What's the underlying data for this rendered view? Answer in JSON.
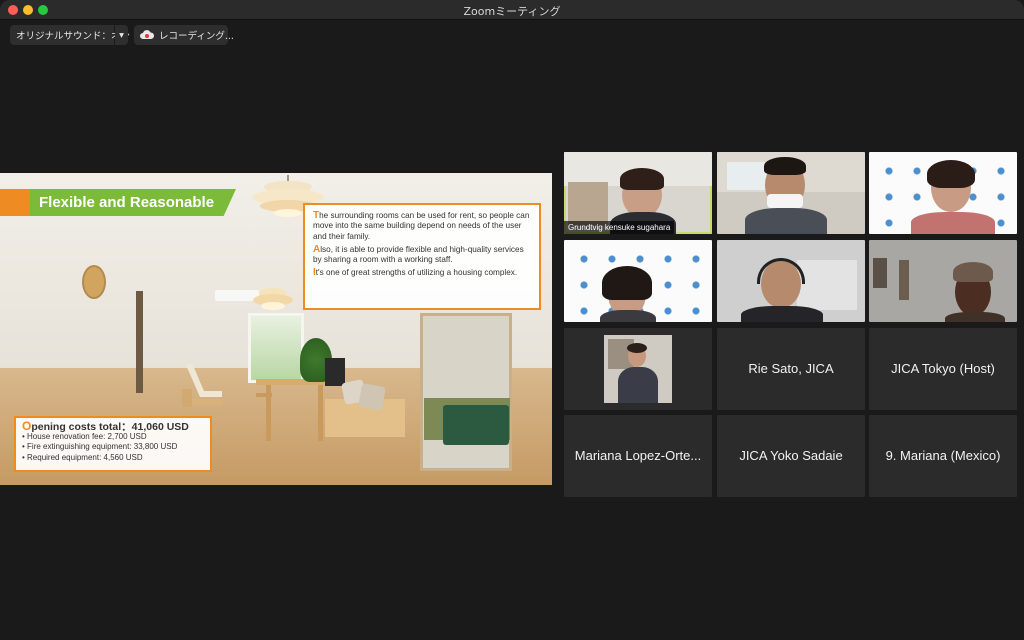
{
  "window": {
    "title": "Zoomミーティング"
  },
  "toolbar": {
    "sound_label": "オリジナルサウンド：オン",
    "dropdown_glyph": "▾",
    "recording_label": "レコーディング..."
  },
  "slide": {
    "banner_title": "Flexible and Reasonable",
    "paragraphs": [
      {
        "cap": "T",
        "rest": "he surrounding rooms can be used for rent, so people can move into the same building depend on needs of the user and their family."
      },
      {
        "cap": "A",
        "rest": "lso, it is able to provide flexible and high-quality services by sharing a room with a working staff."
      },
      {
        "cap": "I",
        "rest": "t's one of great  strengths of utilizing a housing complex."
      }
    ],
    "costs": {
      "cap": "O",
      "title_rest": "pening costs total：41,060 USD",
      "items": [
        "House renovation fee: 2,700 USD",
        "Fire extinguishing equipment: 33,800 USD",
        "Required equipment: 4,560 USD"
      ]
    }
  },
  "participants": [
    {
      "label": "Grundtvig   kensuke sugahara",
      "video": true
    },
    {
      "label": "",
      "video": true
    },
    {
      "label": "",
      "video": true
    },
    {
      "label": "",
      "video": true
    },
    {
      "label": "",
      "video": true
    },
    {
      "label": "",
      "video": true
    },
    {
      "label": "",
      "video": true
    },
    {
      "label": "Rie Sato, JICA",
      "video": false
    },
    {
      "label": "JICA Tokyo (Host)",
      "video": false
    },
    {
      "label": "Mariana Lopez-Orte...",
      "video": false
    },
    {
      "label": "JICA Yoko Sadaie",
      "video": false
    },
    {
      "label": "9. Mariana (Mexico)",
      "video": false
    }
  ],
  "colors": {
    "accent_orange": "#ef8b23",
    "banner_green": "#7cbb3a",
    "active_speaker": "#c9d96a"
  }
}
